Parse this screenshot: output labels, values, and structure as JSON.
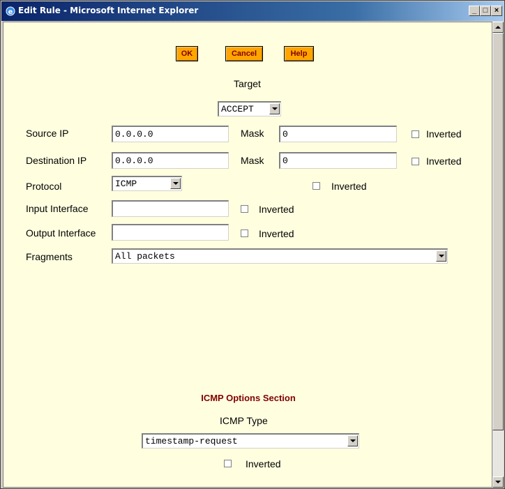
{
  "window": {
    "title": "Edit Rule - Microsoft Internet Explorer",
    "minimize_glyph": "_",
    "maximize_glyph": "□",
    "close_glyph": "×"
  },
  "buttons": {
    "ok": "OK",
    "cancel": "Cancel",
    "help": "Help"
  },
  "target": {
    "label": "Target",
    "value": "ACCEPT"
  },
  "source_ip": {
    "label": "Source IP",
    "value": "0.0.0.0",
    "mask_label": "Mask",
    "mask_value": "0",
    "inverted_label": "Inverted"
  },
  "destination_ip": {
    "label": "Destination IP",
    "value": "0.0.0.0",
    "mask_label": "Mask",
    "mask_value": "0",
    "inverted_label": "Inverted"
  },
  "protocol": {
    "label": "Protocol",
    "value": "ICMP",
    "inverted_label": "Inverted"
  },
  "input_interface": {
    "label": "Input Interface",
    "value": "",
    "inverted_label": "Inverted"
  },
  "output_interface": {
    "label": "Output Interface",
    "value": "",
    "inverted_label": "Inverted"
  },
  "fragments": {
    "label": "Fragments",
    "value": "All packets"
  },
  "icmp": {
    "heading": "ICMP Options Section",
    "type_label": "ICMP Type",
    "type_value": "timestamp-request",
    "inverted_label": "Inverted"
  },
  "colors": {
    "background": "#ffffe0",
    "button": "#ffa500",
    "heading": "#800000",
    "titlebar": "#0a246a"
  },
  "icons": {
    "title_icon": "ie-icon"
  }
}
